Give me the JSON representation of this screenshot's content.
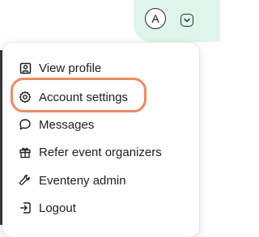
{
  "header": {
    "avatar_initial": "A",
    "account_button_icon": "chevron-down-icon"
  },
  "menu": {
    "items": [
      {
        "label": "View profile",
        "icon": "user-square-icon"
      },
      {
        "label": "Account settings",
        "icon": "gear-icon",
        "highlighted": true
      },
      {
        "label": "Messages",
        "icon": "chat-bubble-icon"
      },
      {
        "label": "Refer event organizers",
        "icon": "gift-icon"
      },
      {
        "label": "Eventeny admin",
        "icon": "wrench-icon"
      },
      {
        "label": "Logout",
        "icon": "logout-icon"
      }
    ]
  },
  "colors": {
    "pill_background": "#dff5ec",
    "highlight_ring": "#f28a5c",
    "text": "#1d1d1d"
  }
}
